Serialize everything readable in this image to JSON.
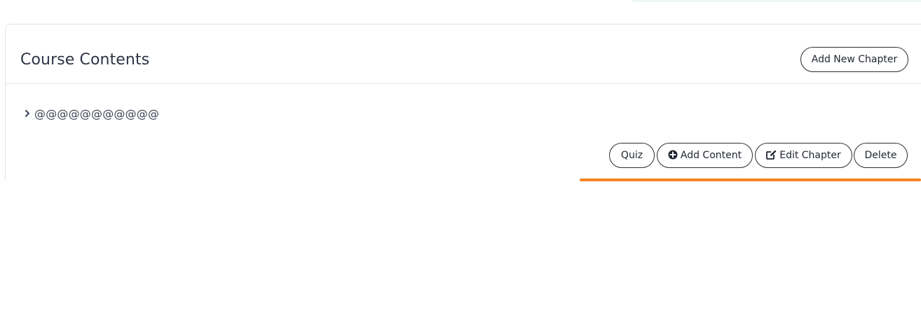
{
  "card": {
    "title": "Course Contents",
    "add_chapter_label": "Add New Chapter"
  },
  "chapter": {
    "title": "@@@@@@@@@@@",
    "actions": {
      "quiz_label": "Quiz",
      "add_content_label": "Add Content",
      "edit_chapter_label": "Edit Chapter",
      "delete_label": "Delete"
    }
  },
  "icons": {
    "chevron": "chevron-right-icon",
    "add_content": "plus-circle-icon",
    "edit_chapter": "edit-icon"
  },
  "colors": {
    "accent_bar": "#f58220",
    "border": "#d9e7ea",
    "button_border": "#2b2f36"
  }
}
